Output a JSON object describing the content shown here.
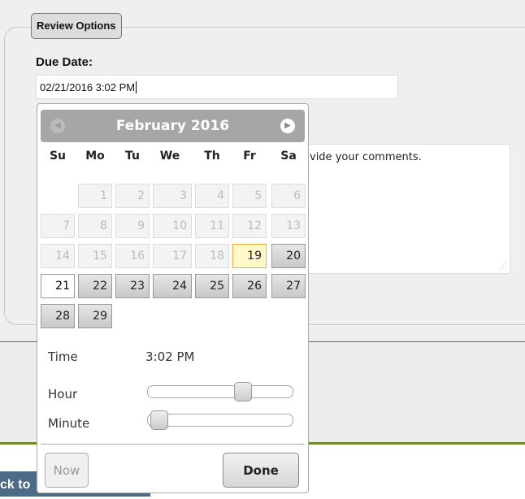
{
  "fieldset": {
    "legend": "Review Options",
    "due_label": "Due Date:",
    "due_value": "02/21/2016 3:02 PM",
    "comments_placeholder": "vide your comments."
  },
  "back_button": "ck to",
  "datepicker": {
    "month_title": "February 2016",
    "prev_icon": "prev-circle-icon",
    "next_icon": "next-circle-icon",
    "weekdays": [
      "Su",
      "Mo",
      "Tu",
      "We",
      "Th",
      "Fr",
      "Sa"
    ],
    "first_weekday_offset": 1,
    "days": 29,
    "today": 19,
    "selected": 21,
    "min_enabled": 19,
    "time_label": "Time",
    "time_value": "3:02 PM",
    "hour_label": "Hour",
    "hour_value": 15,
    "hour_max": 23,
    "minute_label": "Minute",
    "minute_value": 2,
    "minute_max": 59,
    "now_label": "Now",
    "done_label": "Done"
  }
}
